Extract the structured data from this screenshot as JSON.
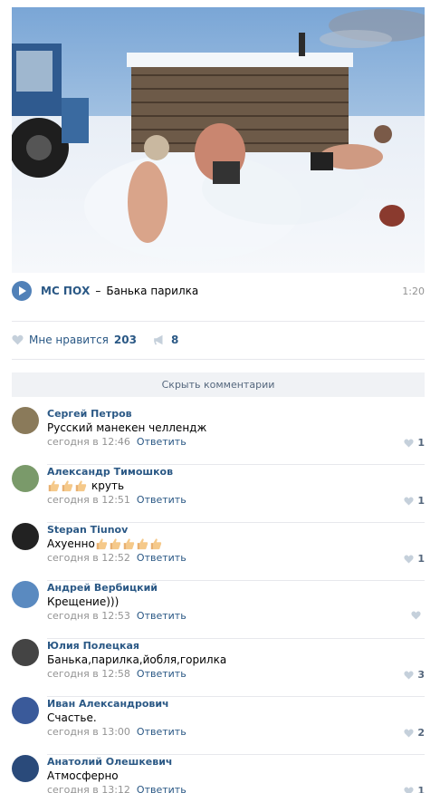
{
  "audio": {
    "artist": "MC ПОХ",
    "separator": "–",
    "title": "Банька парилка",
    "duration": "1:20"
  },
  "actions": {
    "like_label": "Мне нравится",
    "like_count": "203",
    "share_count": "8"
  },
  "hide_comments_label": "Скрыть комментарии",
  "comments": [
    {
      "author": "Сергей Петров",
      "text": "Русский манекен челлендж",
      "thumbs": 0,
      "time": "сегодня в 12:46",
      "reply": "Ответить",
      "likes": "1",
      "avatar_color": "#8a7a5a"
    },
    {
      "author": "Александр Тимошков",
      "text": "круть",
      "thumbs": 3,
      "time": "сегодня в 12:51",
      "reply": "Ответить",
      "likes": "1",
      "avatar_color": "#7a9a6a"
    },
    {
      "author": "Stepan Tiunov",
      "text": "Ахуенно",
      "thumbs": 5,
      "time": "сегодня в 12:52",
      "reply": "Ответить",
      "likes": "1",
      "avatar_color": "#222222"
    },
    {
      "author": "Андрей Вербицкий",
      "text": "Крещение)))",
      "thumbs": 0,
      "time": "сегодня в 12:53",
      "reply": "Ответить",
      "likes": "",
      "avatar_color": "#5a8ac0"
    },
    {
      "author": "Юлия Полецкая",
      "text": "Банька,парилка,йобля,горилка",
      "thumbs": 0,
      "time": "сегодня в 12:58",
      "reply": "Ответить",
      "likes": "3",
      "avatar_color": "#444444"
    },
    {
      "author": "Иван Александрович",
      "text": "Счастье.",
      "thumbs": 0,
      "time": "сегодня в 13:00",
      "reply": "Ответить",
      "likes": "2",
      "avatar_color": "#3a5a9a"
    },
    {
      "author": "Анатолий Олешкевич",
      "text": "Атмосферно",
      "thumbs": 0,
      "time": "сегодня в 13:12",
      "reply": "Ответить",
      "likes": "1",
      "avatar_color": "#2a4a7a"
    }
  ]
}
